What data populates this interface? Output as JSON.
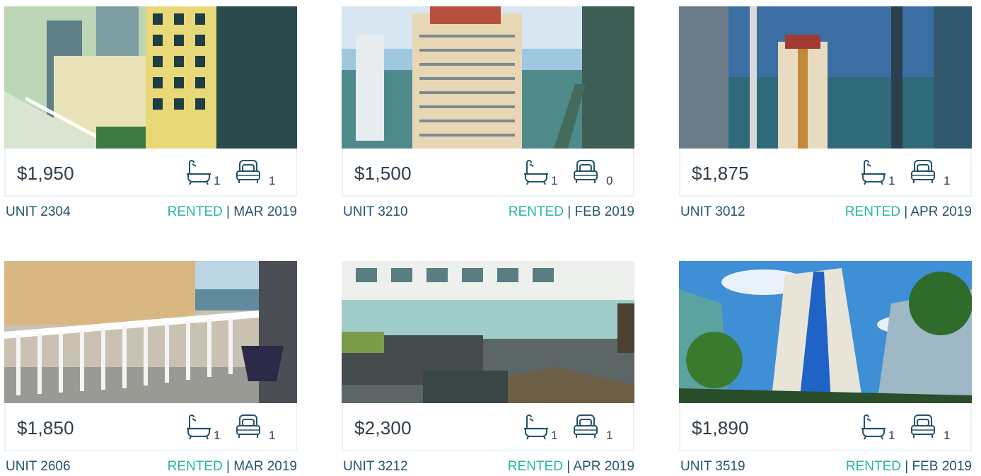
{
  "colors": {
    "rented": "#26b79e",
    "unit_text": "#24536b",
    "price_text": "#2f3d4a",
    "card_border": "#eef2f5"
  },
  "icons": {
    "bath": "bathtub-icon",
    "bed": "bed-icon"
  },
  "listings": [
    {
      "price": "$1,950",
      "baths": "1",
      "beds": "1",
      "unit": "UNIT 2304",
      "status": "RENTED",
      "date": "MAR 2019"
    },
    {
      "price": "$1,500",
      "baths": "1",
      "beds": "0",
      "unit": "UNIT 3210",
      "status": "RENTED",
      "date": "FEB 2019"
    },
    {
      "price": "$1,875",
      "baths": "1",
      "beds": "1",
      "unit": "UNIT 3012",
      "status": "RENTED",
      "date": "APR 2019"
    },
    {
      "price": "$1,850",
      "baths": "1",
      "beds": "1",
      "unit": "UNIT 2606",
      "status": "RENTED",
      "date": "MAR 2019"
    },
    {
      "price": "$2,300",
      "baths": "1",
      "beds": "1",
      "unit": "UNIT 3212",
      "status": "RENTED",
      "date": "APR 2019"
    },
    {
      "price": "$1,890",
      "baths": "1",
      "beds": "1",
      "unit": "UNIT 3519",
      "status": "RENTED",
      "date": "FEB 2019"
    }
  ]
}
